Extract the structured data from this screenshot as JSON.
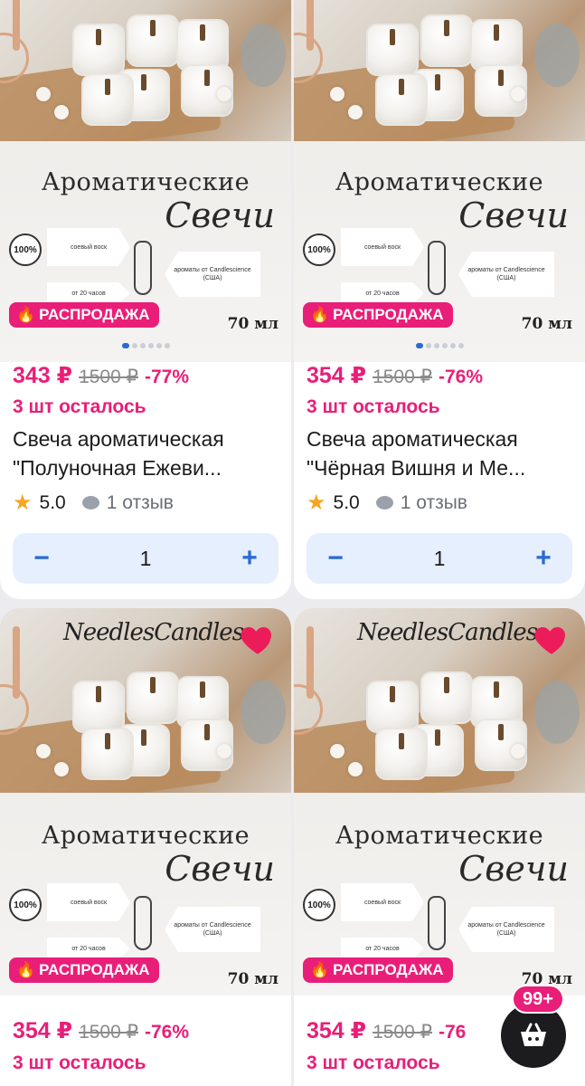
{
  "products": [
    {
      "brand": "",
      "title_line1": "Ароматические",
      "title_line2": "Свечи",
      "badge_100": "100%",
      "soy_wax": "соевый воск",
      "aroma": "ароматы от Candlescience (США)",
      "hours": "от 20 часов",
      "sale_label": "РАСПРОДАЖА",
      "volume": "70 мл",
      "price": "343 ₽",
      "old_price": "1500 ₽",
      "discount": "-77%",
      "stock_left": "3 шт осталось",
      "name_line1": "Свеча ароматическая",
      "name_line2": "\"Полуночная Ежеви...",
      "rating": "5.0",
      "reviews": "1 отзыв",
      "qty": "1",
      "minus": "−",
      "plus": "+"
    },
    {
      "brand": "",
      "title_line1": "Ароматические",
      "title_line2": "Свечи",
      "badge_100": "100%",
      "soy_wax": "соевый воск",
      "aroma": "ароматы от Candlescience (США)",
      "hours": "от 20 часов",
      "sale_label": "РАСПРОДАЖА",
      "volume": "70 мл",
      "price": "354 ₽",
      "old_price": "1500 ₽",
      "discount": "-76%",
      "stock_left": "3 шт осталось",
      "name_line1": "Свеча ароматическая",
      "name_line2": "\"Чёрная Вишня и Ме...",
      "rating": "5.0",
      "reviews": "1 отзыв",
      "qty": "1",
      "minus": "−",
      "plus": "+"
    },
    {
      "brand": "NeedlesCandles",
      "title_line1": "Ароматические",
      "title_line2": "Свечи",
      "badge_100": "100%",
      "soy_wax": "соевый воск",
      "aroma": "ароматы от Candlescience (США)",
      "hours": "от 20 часов",
      "sale_label": "РАСПРОДАЖА",
      "volume": "70 мл",
      "price": "354 ₽",
      "old_price": "1500 ₽",
      "discount": "-76%",
      "stock_left": "3 шт осталось"
    },
    {
      "brand": "NeedlesCandles",
      "title_line1": "Ароматические",
      "title_line2": "Свечи",
      "badge_100": "100%",
      "soy_wax": "соевый воск",
      "aroma": "ароматы от Candlescience (США)",
      "hours": "от 20 часов",
      "sale_label": "РАСПРОДАЖА",
      "volume": "70 мл",
      "price": "354 ₽",
      "old_price": "1500 ₽",
      "discount": "-76",
      "stock_left": "3 шт осталось"
    }
  ],
  "cart": {
    "count": "99+",
    "icon": "basket-icon"
  },
  "colors": {
    "accent_pink": "#e91e78",
    "accent_blue": "#2a6ad8",
    "star": "#f5a623"
  }
}
